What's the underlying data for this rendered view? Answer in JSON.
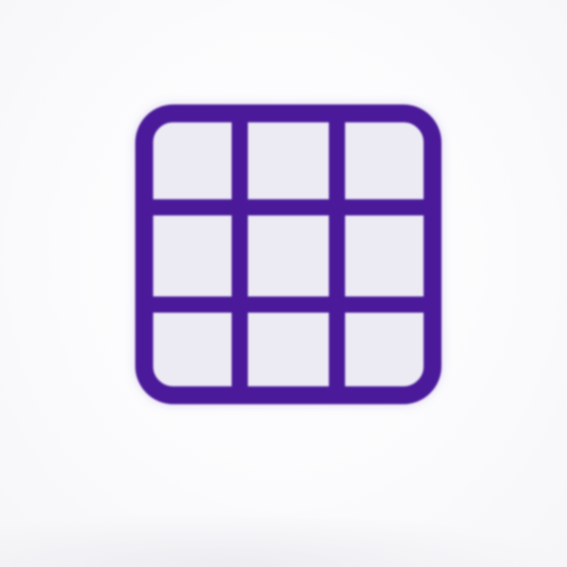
{
  "icon": {
    "name": "grid-icon",
    "rows": 3,
    "columns": 3,
    "color": "#4b1a9a",
    "cell_fill": "#ecebf4"
  },
  "background": "#ffffff"
}
